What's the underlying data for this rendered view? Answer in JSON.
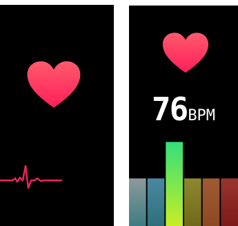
{
  "heart_rate": {
    "value": "76",
    "unit": "BPM"
  },
  "colors": {
    "background": "#000000",
    "heart_top": "#ff5a6c",
    "heart_bottom": "#ff1f5a",
    "ecg_line": "#e8245a"
  },
  "icons": {
    "left_heart": "heart-icon",
    "right_heart": "heart-icon",
    "waveform": "ecg-waveform-icon"
  },
  "zones": {
    "active_index": 2,
    "items": [
      {
        "level": 0.43,
        "top": "#8c9a9c",
        "bottom": "#3d7d83"
      },
      {
        "level": 0.43,
        "top": "#4a88a1",
        "bottom": "#2e707a"
      },
      {
        "level": 0.76,
        "top": "#33e07a",
        "bottom": "#c7ee24"
      },
      {
        "level": 0.43,
        "top": "#8e8830",
        "bottom": "#706917"
      },
      {
        "level": 0.43,
        "top": "#a05a34",
        "bottom": "#8c4a22"
      },
      {
        "level": 0.43,
        "top": "#9a342e",
        "bottom": "#7c1b19"
      }
    ]
  }
}
